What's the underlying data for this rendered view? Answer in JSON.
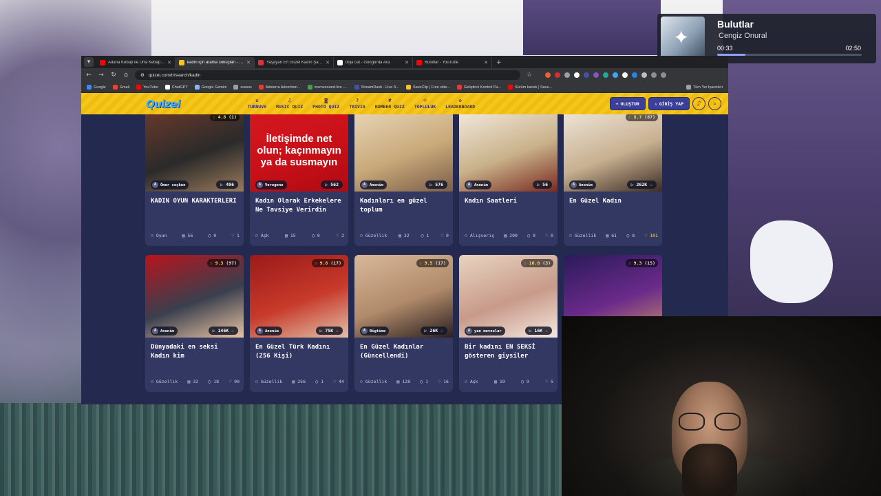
{
  "media_player": {
    "song": "Bulutlar",
    "artist": "Cengiz Onural",
    "current_time": "00:33",
    "duration": "02:50",
    "progress": 0.194
  },
  "browser": {
    "tabs": [
      {
        "title": "Adana Kebap ile Urfa Kebap A...",
        "color": "#ff0000"
      },
      {
        "title": "kadın için arama sonuçları - Qu...",
        "color": "#f5c61c",
        "active": true
      },
      {
        "title": "Yaşayan En Güzel Kadın Şarkıc...",
        "color": "#e0313a"
      },
      {
        "title": "doja cat - Google'da Ara",
        "color": "#ffffff"
      },
      {
        "title": "Bulutlar - YouTube",
        "color": "#ff0000"
      }
    ],
    "url": "quizei.com/tr/search/kadin",
    "bookmarks": [
      {
        "label": "Google",
        "color": "#4285f4"
      },
      {
        "label": "Gmail",
        "color": "#ea4335"
      },
      {
        "label": "YouTube",
        "color": "#ff0000"
      },
      {
        "label": "ChatGPT",
        "color": "#ffffff"
      },
      {
        "label": "Google Gemini",
        "color": "#8ab4f8"
      },
      {
        "label": "ssssss",
        "color": "#9aa0a6"
      },
      {
        "label": "Adsterra Advertisin...",
        "color": "#e53935"
      },
      {
        "label": "memesound.live -...",
        "color": "#43a047"
      },
      {
        "label": "StreamDash - Live S...",
        "color": "#3f51b5"
      },
      {
        "label": "SaveClip | Free vide...",
        "color": "#fbc02d"
      },
      {
        "label": "Geliştirici Kontrol Pa...",
        "color": "#e53935"
      },
      {
        "label": "Sürüm kanalı | Save...",
        "color": "#ff0000"
      }
    ],
    "bookmarks_right": "Tüm Yer İşaretleri"
  },
  "site": {
    "logo": "Quizei",
    "nav": [
      {
        "label": "TURNUVA",
        "icon": "trophy-icon",
        "glyph": "♛"
      },
      {
        "label": "MUSIC QUIZ",
        "icon": "music-icon",
        "glyph": "♫"
      },
      {
        "label": "PHOTO QUIZ",
        "icon": "camera-icon",
        "glyph": "◙"
      },
      {
        "label": "TRIVIA",
        "icon": "question-icon",
        "glyph": "?"
      },
      {
        "label": "NUMBER QUIZ",
        "icon": "hash-icon",
        "glyph": "#"
      },
      {
        "label": "TOPLULUK",
        "icon": "community-icon",
        "glyph": "☺"
      },
      {
        "label": "LEADERBOARD",
        "icon": "medal-icon",
        "glyph": "✪"
      }
    ],
    "create_label": "OLUŞTUR",
    "login_label": "GİRİŞ YAP"
  },
  "cards": [
    {
      "thumb_colors": [
        "#6b3a2a",
        "#2a2a2a",
        "#9a7a5a"
      ],
      "rating": "4.8",
      "rating_count": "(1)",
      "author": "Ömer coşkun",
      "plays": "496",
      "hot": false,
      "title": "KADIN OYUN KARAKTERLERI",
      "category": "Oyun",
      "questions": "56",
      "comments": "0",
      "likes": "1",
      "likes_highlight": false
    },
    {
      "thumb_colors": [
        "#d51820",
        "#c81018",
        "#b00a12"
      ],
      "thumb_text": "İletişimde net olun; kaçınmayın ya da susmayın",
      "author": "Verogono",
      "plays": "562",
      "hot": false,
      "title": "Kadın Olarak Erkekelere Ne Tavsiye Verirdin",
      "category": "Aşk",
      "questions": "15",
      "comments": "0",
      "likes": "2",
      "likes_highlight": false
    },
    {
      "thumb_colors": [
        "#e8d6b8",
        "#c9a97a",
        "#7a5e48"
      ],
      "author": "Anonim",
      "plays": "576",
      "hot": false,
      "title": "Kadınları en güzel toplum",
      "category": "Güzellik",
      "questions": "32",
      "comments": "1",
      "likes": "0",
      "likes_highlight": false
    },
    {
      "thumb_colors": [
        "#f3eadf",
        "#c9b28a",
        "#7a2a20"
      ],
      "author": "Anonim",
      "plays": "56",
      "hot": false,
      "title": "Kadın Saatleri",
      "category": "Alışveriş",
      "questions": "200",
      "comments": "0",
      "likes": "0",
      "likes_highlight": false
    },
    {
      "thumb_colors": [
        "#efe7dc",
        "#c8b090",
        "#3c2c24"
      ],
      "rating": "8.7",
      "rating_count": "(87)",
      "author": "Anonim",
      "plays": "262K",
      "hot": true,
      "title": "En Güzel Kadın",
      "category": "Güzellik",
      "questions": "61",
      "comments": "8",
      "likes": "101",
      "likes_highlight": true
    },
    {
      "thumb_colors": [
        "#b8141c",
        "#3a3f4e",
        "#e8c2a0"
      ],
      "rating": "9.3",
      "rating_count": "(97)",
      "author": "Anonim",
      "plays": "146K",
      "hot": true,
      "title": "Dünyadaki en seksi Kadın kim",
      "category": "Güzellik",
      "questions": "32",
      "comments": "18",
      "likes": "90",
      "likes_highlight": false
    },
    {
      "thumb_colors": [
        "#9a1a1a",
        "#c83a2a",
        "#e0c0a8"
      ],
      "rating": "9.6",
      "rating_count": "(17)",
      "author": "Anonim",
      "plays": "75K",
      "hot": true,
      "title": "En Güzel Türk Kadını (256 Kişi)",
      "category": "Güzellik",
      "questions": "256",
      "comments": "1",
      "likes": "44",
      "likes_highlight": false
    },
    {
      "thumb_colors": [
        "#d8b89a",
        "#b08a6a",
        "#2a2020"
      ],
      "rating": "9.5",
      "rating_count": "(17)",
      "author": "Bigtime",
      "plays": "26K",
      "hot": true,
      "title": "En Güzel Kadınlar (Güncellendi)",
      "category": "Güzellik",
      "questions": "128",
      "comments": "1",
      "likes": "16",
      "likes_highlight": false
    },
    {
      "thumb_colors": [
        "#e8d4c0",
        "#c89a8a",
        "#f4e8de"
      ],
      "rating": "10.0",
      "rating_count": "(3)",
      "author": "yan mevzular",
      "plays": "16K",
      "hot": true,
      "title": "Bir kadını EN SEKSİ gösteren giysiler",
      "category": "Aşk",
      "questions": "19",
      "comments": "9",
      "likes": "5",
      "likes_highlight": false
    },
    {
      "thumb_colors": [
        "#2a1a5a",
        "#6a2a8a",
        "#c88a6a"
      ],
      "rating": "9.3",
      "rating_count": "(15)"
    }
  ]
}
